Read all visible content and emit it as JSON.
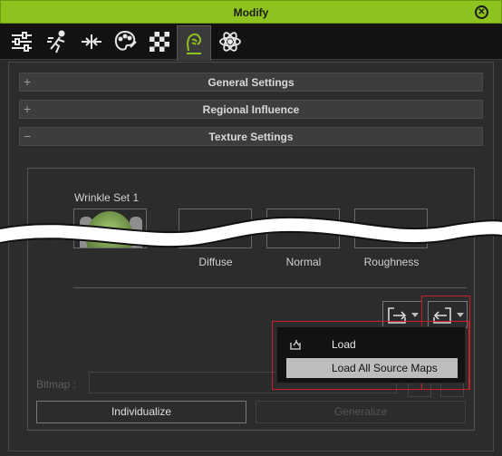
{
  "window": {
    "title": "Modify"
  },
  "toolbar": {
    "tabs": [
      {
        "icon": "sliders-icon"
      },
      {
        "icon": "motion-icon"
      },
      {
        "icon": "align-icon"
      },
      {
        "icon": "palette-icon"
      },
      {
        "icon": "checker-icon"
      },
      {
        "icon": "face-wrinkle-icon",
        "active": true
      },
      {
        "icon": "physics-icon"
      }
    ]
  },
  "sections": {
    "general": {
      "sign": "+",
      "label": "General Settings"
    },
    "regional": {
      "sign": "+",
      "label": "Regional Influence"
    },
    "texture": {
      "sign": "−",
      "label": "Texture Settings"
    }
  },
  "texture": {
    "set_label": "Wrinkle Set 1",
    "channels": [
      "Diffuse",
      "Normal",
      "Roughness"
    ]
  },
  "bitmap": {
    "label": "Bitmap :"
  },
  "buttons": {
    "individualize": "Individualize",
    "generalize": "Generalize"
  },
  "dropdown": {
    "items": [
      {
        "label": "Load",
        "icon": "load-folder-icon"
      },
      {
        "label": "Load All Source Maps",
        "highlighted": true
      }
    ]
  },
  "colors": {
    "titlebar": "#8dc21f",
    "accent_red": "#c8202a",
    "highlight": "#bdbdbd"
  }
}
